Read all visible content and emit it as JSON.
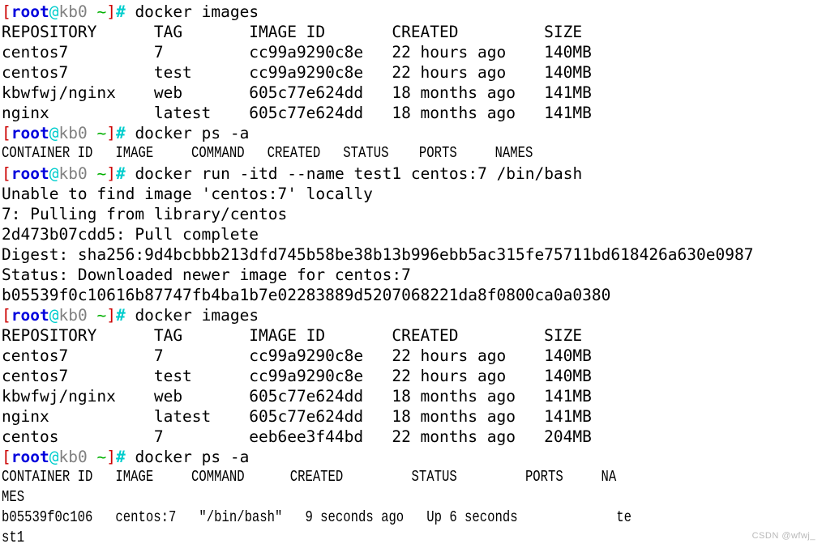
{
  "terminal": {
    "background_color": "#ffffff",
    "foreground_color": "#000000",
    "prompt_colors": {
      "bracket": "#cc0000",
      "user": "#0000dd",
      "at": "#00cdcd",
      "host": "#808080",
      "path": "#00b000",
      "hash": "#00cdcd"
    },
    "prompt": {
      "open_bracket": "[",
      "user": "root",
      "at": "@",
      "host": "kb0",
      "space": " ",
      "path": "~",
      "close_bracket": "]",
      "hash": "#"
    },
    "commands": {
      "cmd1": " docker images",
      "cmd2": " docker ps -a",
      "cmd3": " docker run -itd --name test1 centos:7 /bin/bash",
      "cmd4": " docker images",
      "cmd5": " docker ps -a"
    },
    "images_table_1": {
      "header": "REPOSITORY      TAG       IMAGE ID       CREATED         SIZE",
      "rows": [
        "centos7         7         cc99a9290c8e   22 hours ago    140MB",
        "centos7         test      cc99a9290c8e   22 hours ago    140MB",
        "kbwfwj/nginx    web       605c77e624dd   18 months ago   141MB",
        "nginx           latest    605c77e624dd   18 months ago   141MB"
      ]
    },
    "ps_table_1": {
      "header": "CONTAINER ID   IMAGE     COMMAND   CREATED   STATUS    PORTS     NAMES"
    },
    "run_output": {
      "line1": "Unable to find image 'centos:7' locally",
      "line2": "7: Pulling from library/centos",
      "line3": "2d473b07cdd5: Pull complete",
      "line4": "Digest: sha256:9d4bcbbb213dfd745b58be38b13b996ebb5ac315fe75711bd618426a630e0987",
      "line5": "Status: Downloaded newer image for centos:7",
      "line6": "b05539f0c10616b87747fb4ba1b7e02283889d5207068221da8f0800ca0a0380"
    },
    "images_table_2": {
      "header": "REPOSITORY      TAG       IMAGE ID       CREATED         SIZE",
      "rows": [
        "centos7         7         cc99a9290c8e   22 hours ago    140MB",
        "centos7         test      cc99a9290c8e   22 hours ago    140MB",
        "kbwfwj/nginx    web       605c77e624dd   18 months ago   141MB",
        "nginx           latest    605c77e624dd   18 months ago   141MB",
        "centos          7         eeb6ee3f44bd   22 months ago   204MB"
      ]
    },
    "ps_table_2": {
      "header_part1": "CONTAINER ID   IMAGE     COMMAND      CREATED         STATUS         PORTS     NA",
      "header_part2": "MES",
      "row_part1": "b05539f0c106   centos:7   \"/bin/bash\"   9 seconds ago   Up 6 seconds             te",
      "row_part2": "st1"
    },
    "watermark": "CSDN @wfwj_"
  }
}
